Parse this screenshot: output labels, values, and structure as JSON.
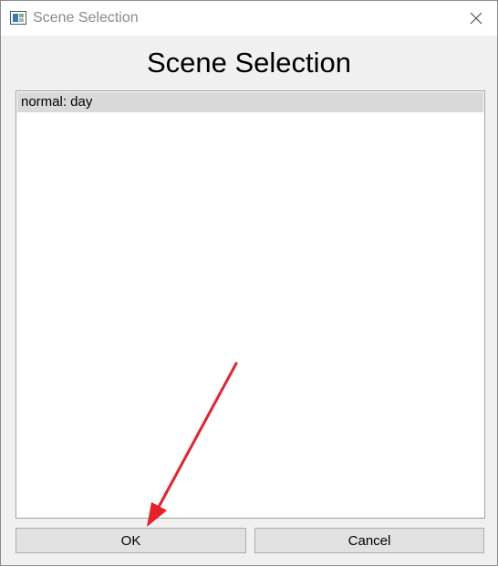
{
  "window": {
    "title": "Scene Selection",
    "icon": "app-window-icon",
    "close_icon": "close-icon"
  },
  "dialog": {
    "heading": "Scene Selection"
  },
  "scene_list": {
    "items": [
      {
        "label": "normal: day",
        "selected": true
      }
    ]
  },
  "buttons": {
    "ok_label": "OK",
    "cancel_label": "Cancel"
  },
  "annotation": {
    "arrow_color": "#e8202a",
    "target": "ok-button"
  },
  "colors": {
    "window_bg": "#f0f0f0",
    "titlebar_bg": "#ffffff",
    "selection_bg": "#d9d9d9",
    "button_bg": "#e1e1e1"
  }
}
